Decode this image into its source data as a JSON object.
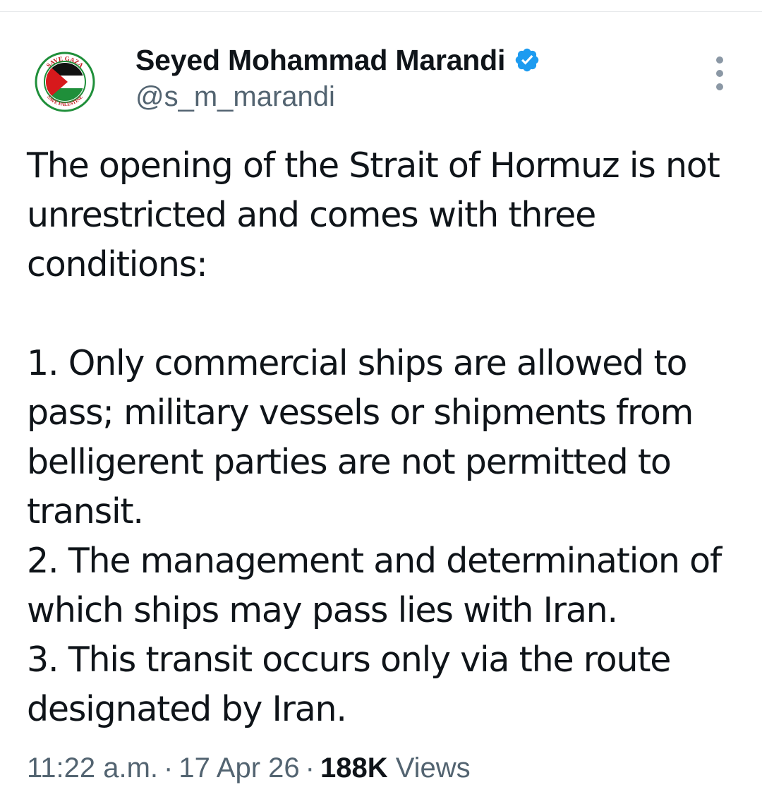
{
  "author": {
    "display_name": "Seyed Mohammad Marandi",
    "handle": "@s_m_marandi",
    "verified": true,
    "verified_color": "#1d9bf0",
    "avatar": {
      "description_icon": "palestine-flag-badge-icon",
      "ring_top_text": "SAVE GAZA",
      "ring_bottom_text": "SAVE PALESTINE",
      "ring_color": "#1f8f3a"
    }
  },
  "tweet": {
    "text": "The opening of the Strait of Hormuz is not unrestricted and comes with three conditions:\n\n1. Only commercial ships are allowed to pass; military vessels or shipments from belligerent parties are not permitted to transit.\n2. The management and determination of which ships may pass lies with Iran.\n3. This transit occurs only via the route designated by Iran."
  },
  "meta": {
    "time": "11:22 a.m.",
    "separator": "·",
    "date": "17 Apr 26",
    "views_count": "188K",
    "views_label": "Views"
  },
  "colors": {
    "text_primary": "#0f1419",
    "text_secondary": "#536471",
    "more_dots": "#8b98a5"
  }
}
